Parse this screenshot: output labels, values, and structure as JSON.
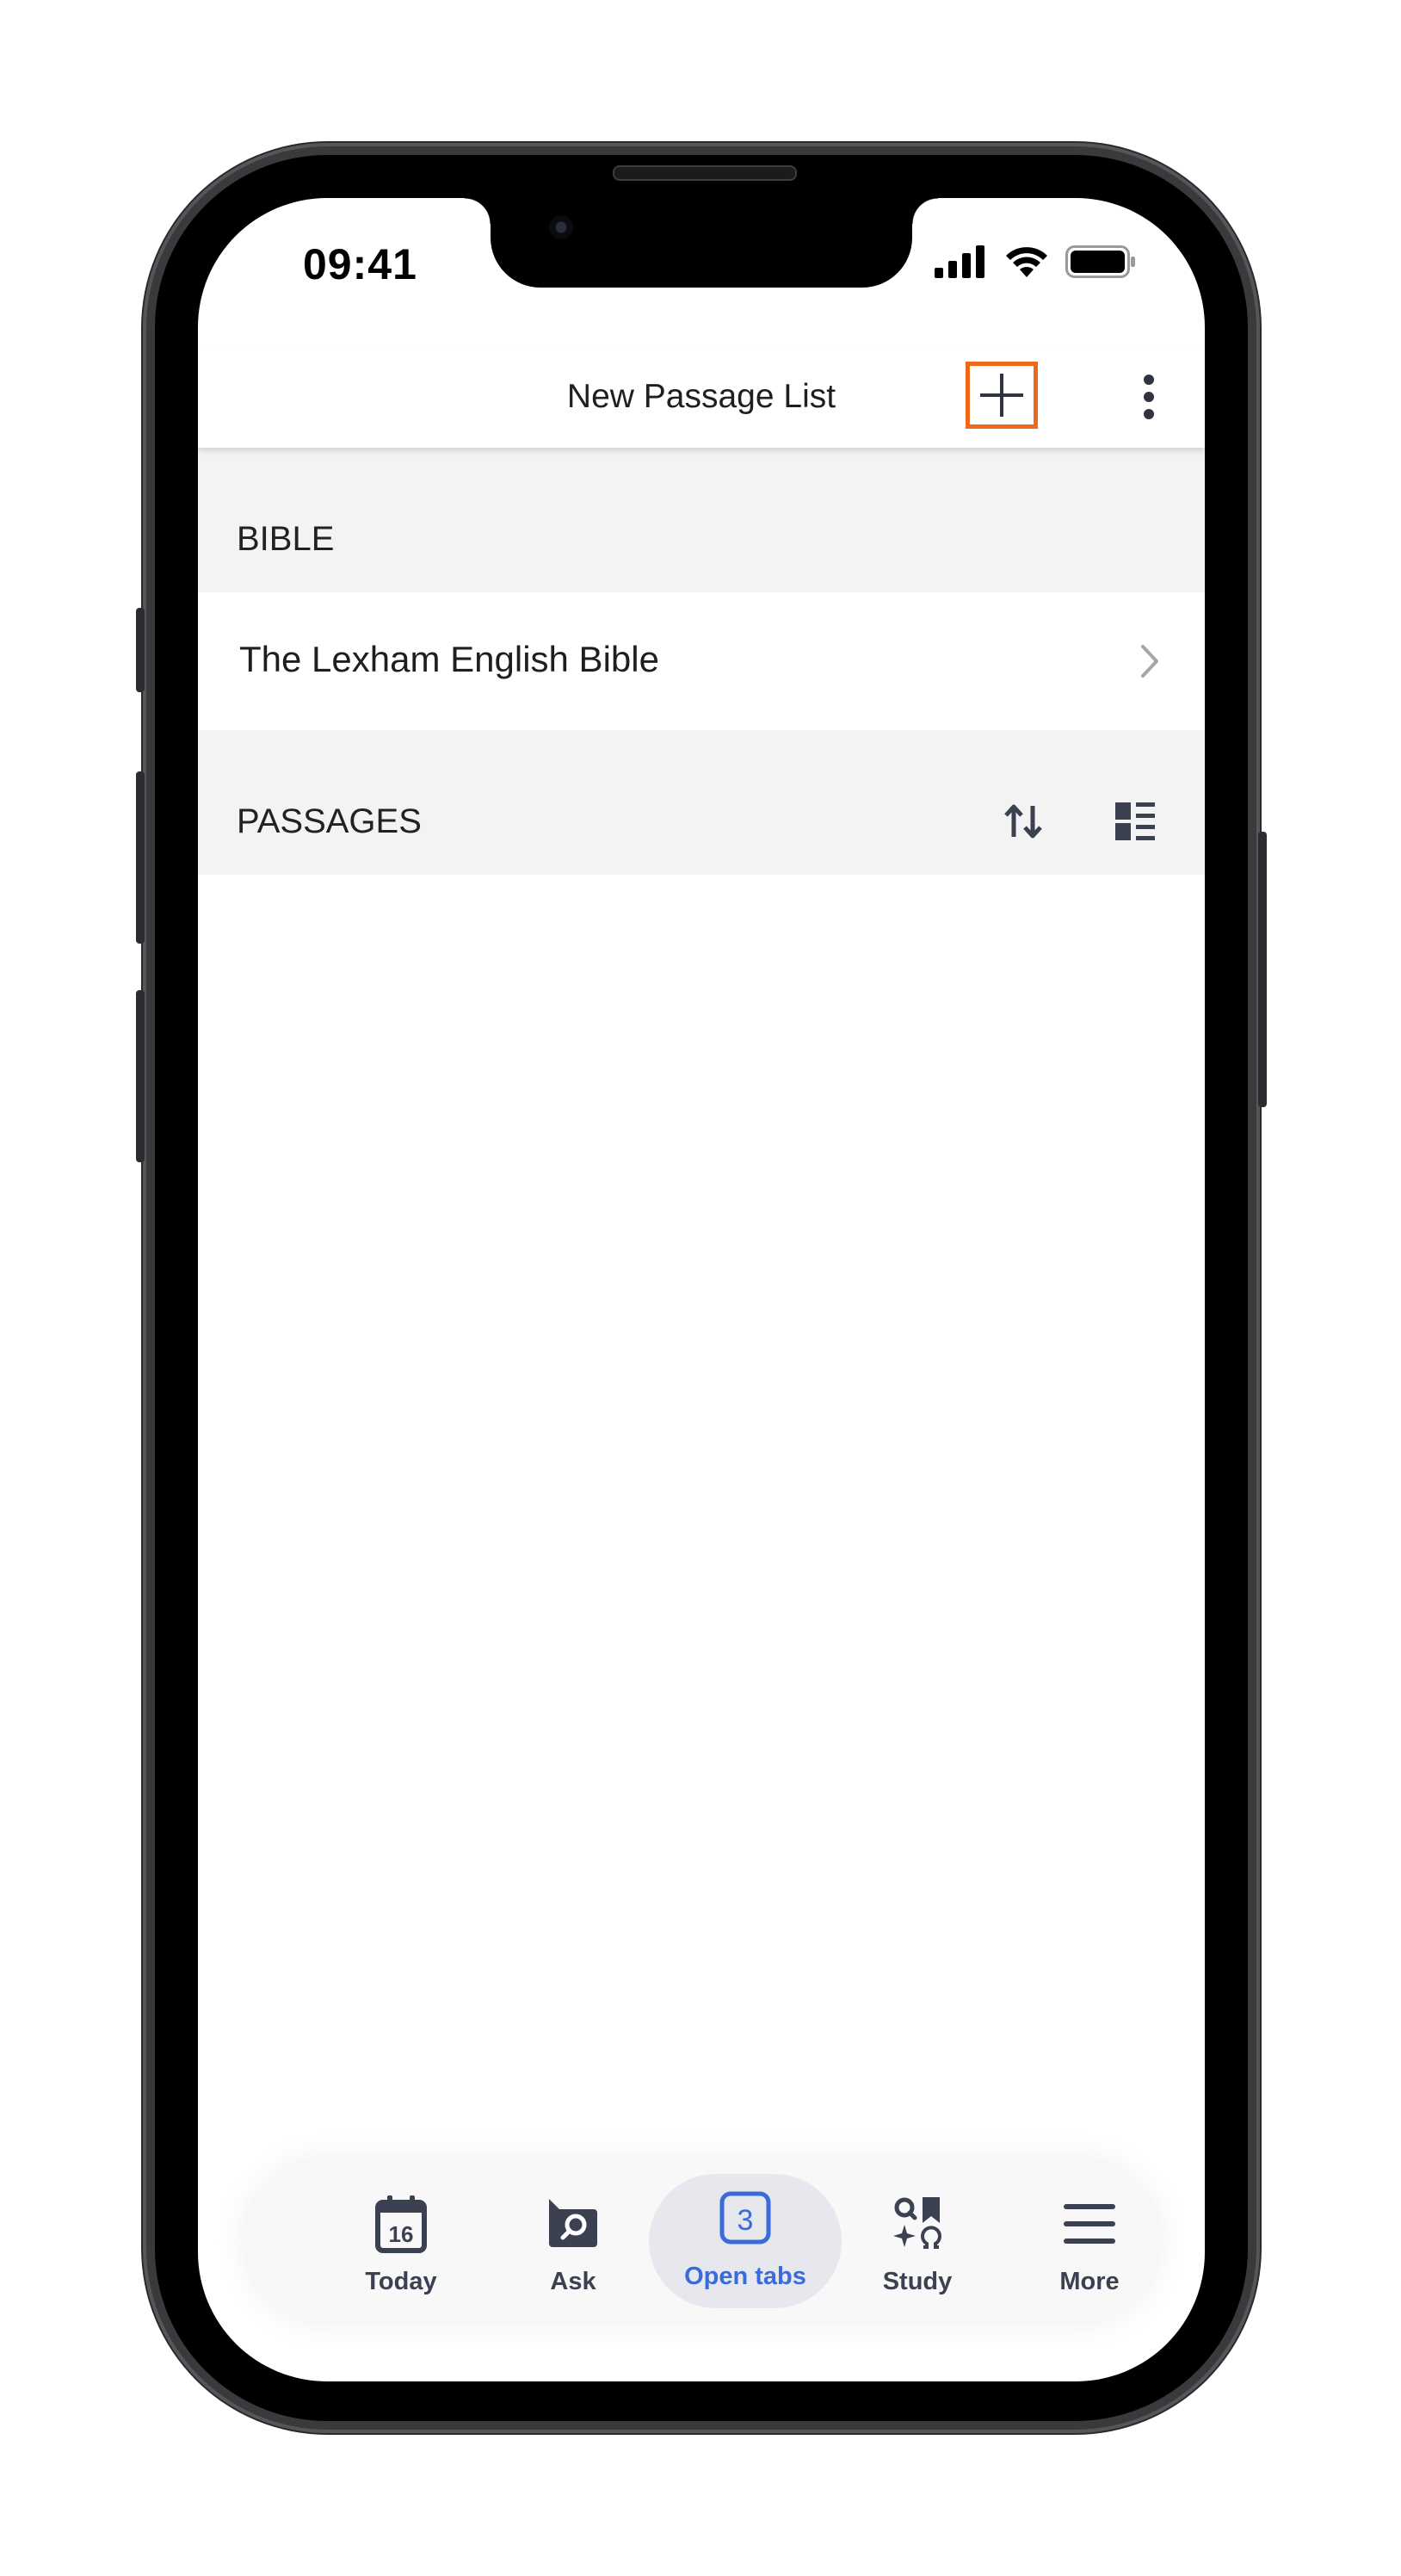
{
  "status_bar": {
    "time": "09:41"
  },
  "nav": {
    "title": "New Passage List"
  },
  "sections": {
    "bible": {
      "header": "BIBLE",
      "row_label": "The Lexham English Bible"
    },
    "passages": {
      "header": "PASSAGES"
    }
  },
  "tabbar": {
    "tabs": [
      {
        "label": "Today",
        "icon": "calendar-icon",
        "badge": "16"
      },
      {
        "label": "Ask",
        "icon": "ask-search-bubble-icon"
      },
      {
        "label": "Open tabs",
        "icon": "tabs-count-icon",
        "badge": "3",
        "active": true
      },
      {
        "label": "Study",
        "icon": "study-icon"
      },
      {
        "label": "More",
        "icon": "hamburger-menu-icon"
      }
    ]
  },
  "colors": {
    "highlight": "#ee6a1b",
    "active_tab": "#3a6bd9",
    "section_bg": "#f3f3f3",
    "icon": "#3b4150"
  }
}
